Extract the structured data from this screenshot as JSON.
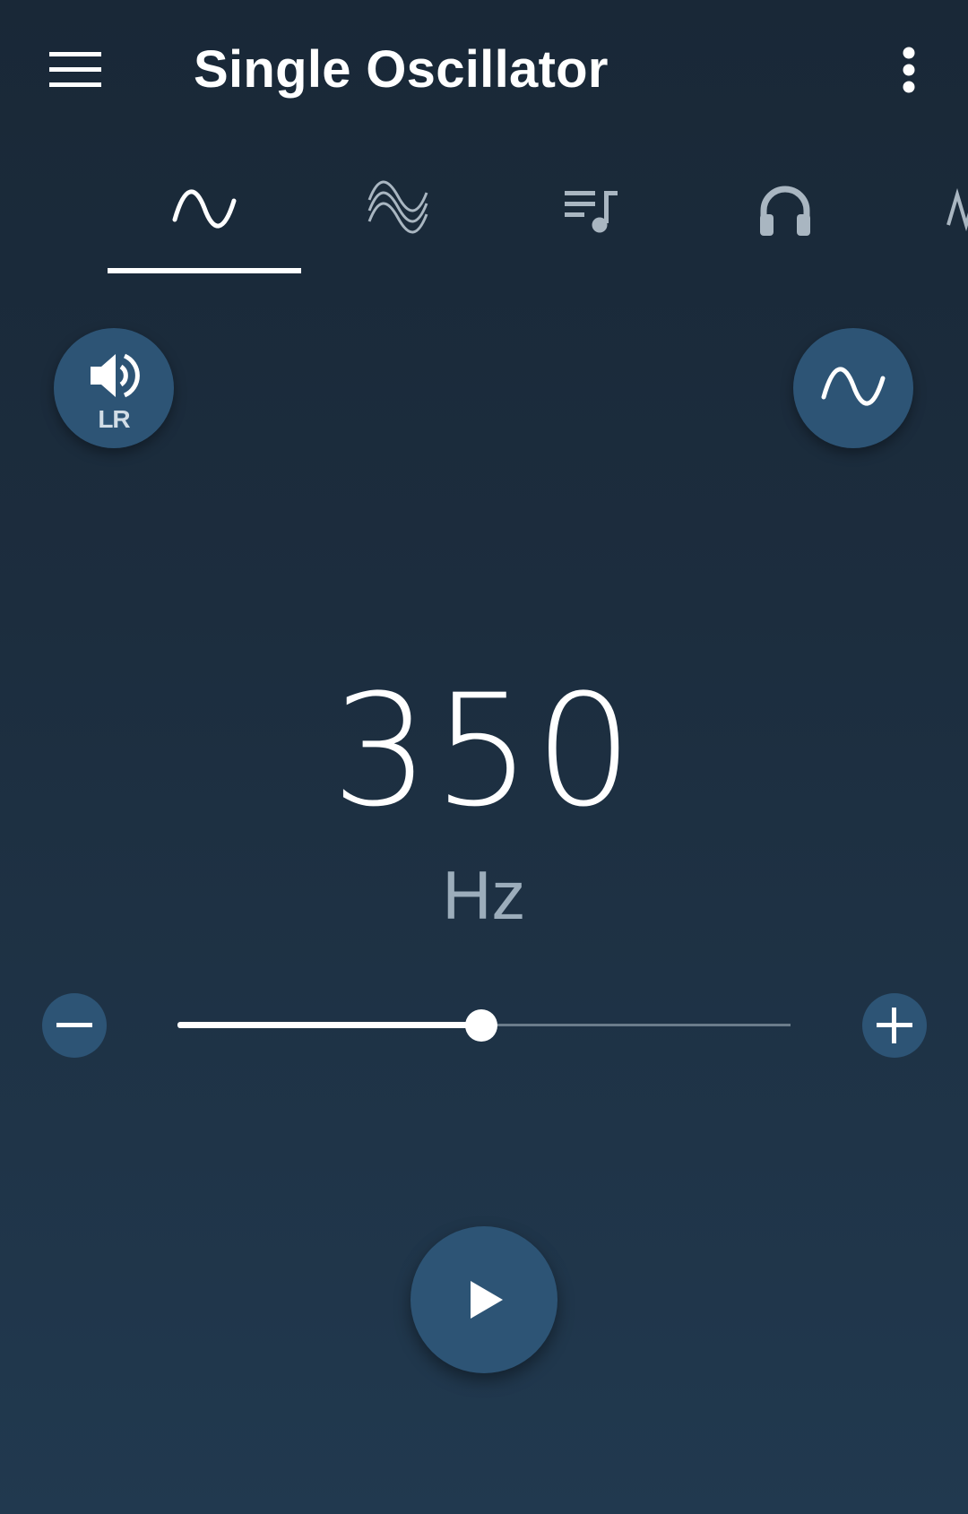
{
  "app_bar": {
    "title": "Single Oscillator",
    "menu_icon": "hamburger-menu-icon",
    "overflow_icon": "more-vertical-icon"
  },
  "tabs": [
    {
      "icon": "sine-wave-icon",
      "selected": true
    },
    {
      "icon": "multi-wave-icon",
      "selected": false
    },
    {
      "icon": "playlist-music-icon",
      "selected": false
    },
    {
      "icon": "headphones-icon",
      "selected": false
    },
    {
      "icon": "sweep-wave-icon",
      "selected": false
    }
  ],
  "controls": {
    "channel_button": {
      "icon": "volume-icon",
      "label": "LR"
    },
    "waveform_button": {
      "icon": "sine-wave-icon"
    }
  },
  "frequency": {
    "value": "350",
    "unit": "Hz",
    "slider_fraction": 0.495
  },
  "colors": {
    "background_top": "#192837",
    "background_bottom": "#21394f",
    "button": "#2d5475",
    "unit_text": "#9cadbb",
    "track": "#6b7c8b"
  }
}
